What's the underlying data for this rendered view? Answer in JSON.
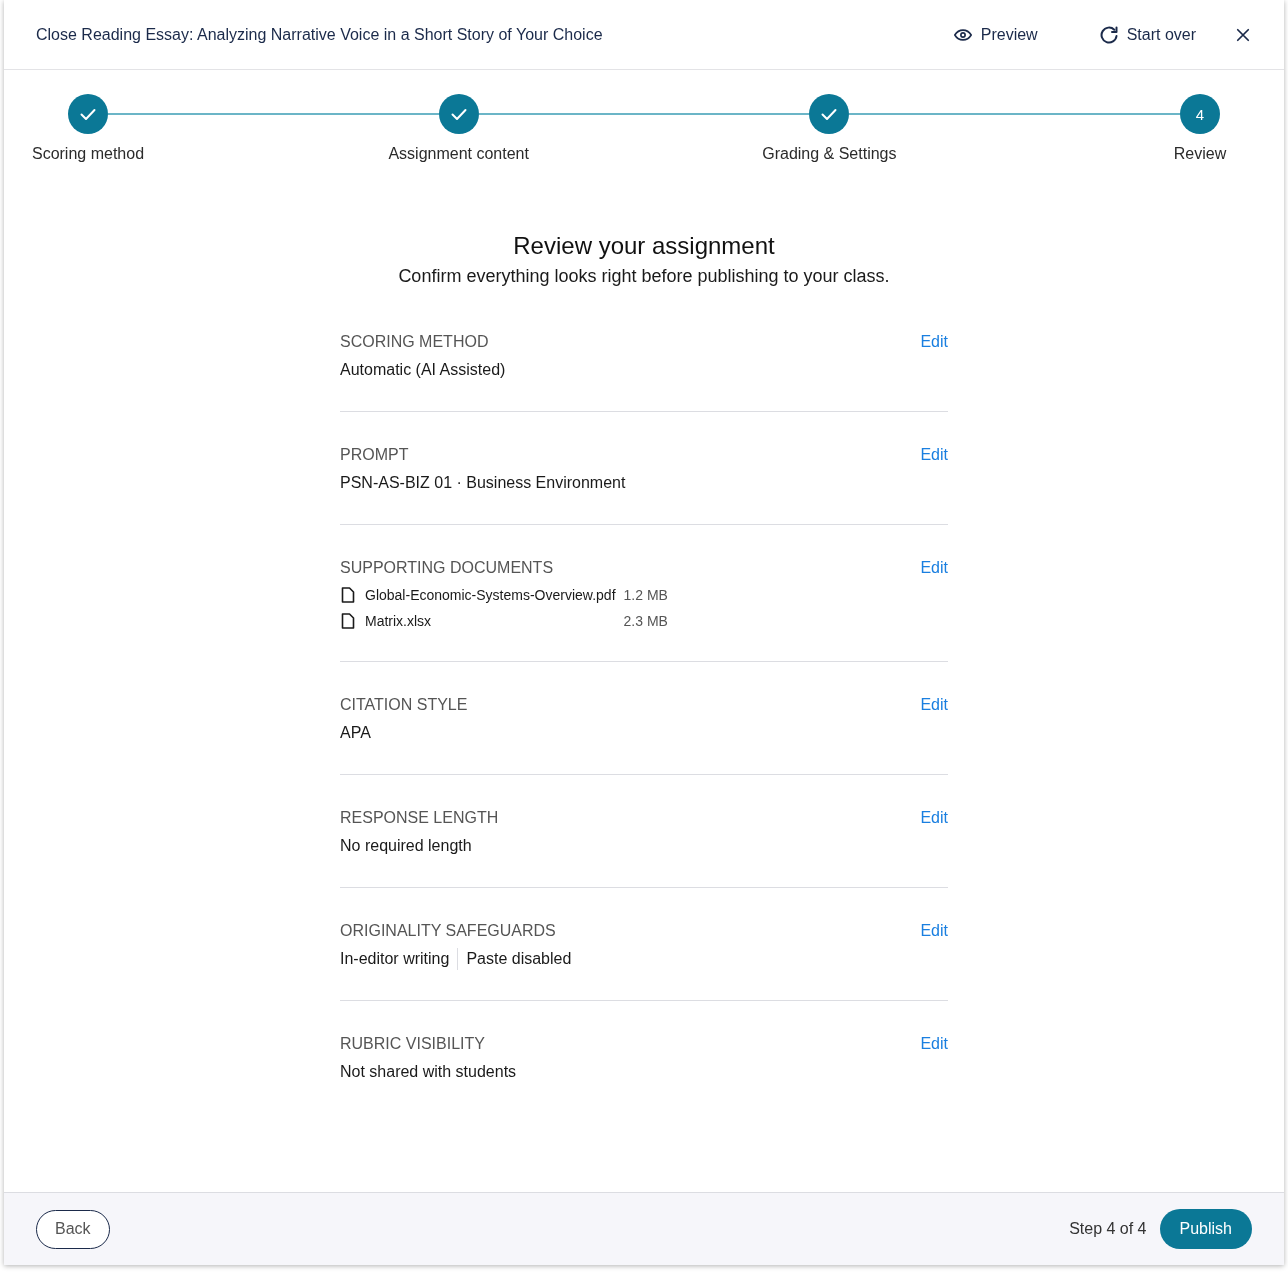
{
  "header": {
    "title": "Close Reading Essay: Analyzing Narrative Voice in a Short Story of Your Choice",
    "actions": [
      {
        "kind": "preview",
        "label": "Preview"
      },
      {
        "kind": "restart",
        "label": "Start over"
      }
    ]
  },
  "stepper": [
    {
      "label": "Scoring method",
      "completed": true
    },
    {
      "label": "Assignment content",
      "completed": true
    },
    {
      "label": "Grading & Settings",
      "completed": true
    },
    {
      "label": "Review",
      "completed": false,
      "number": "4"
    }
  ],
  "review": {
    "title": "Review your assignment",
    "subtitle": "Confirm everything looks right before publishing to your class.",
    "sections": [
      {
        "kind": "text",
        "heading": "SCORING METHOD",
        "edit": "Edit",
        "value": "Automatic (AI Assisted)"
      },
      {
        "kind": "text",
        "heading": "PROMPT",
        "edit": "Edit",
        "value": "PSN-AS-BIZ 01 · Business Environment"
      },
      {
        "kind": "files",
        "heading": "SUPPORTING DOCUMENTS",
        "edit": "Edit",
        "files": [
          {
            "name": "Global-Economic-Systems-Overview.pdf",
            "size": "1.2 MB"
          },
          {
            "name": "Matrix.xlsx",
            "size": "2.3 MB"
          }
        ]
      },
      {
        "kind": "text",
        "heading": "CITATION STYLE",
        "edit": "Edit",
        "value": "APA"
      },
      {
        "kind": "text",
        "heading": "RESPONSE LENGTH",
        "edit": "Edit",
        "value": "No required length"
      },
      {
        "kind": "tags",
        "heading": "ORIGINALITY SAFEGUARDS",
        "edit": "Edit",
        "tags": [
          "In-editor writing",
          "Paste disabled"
        ]
      },
      {
        "kind": "text",
        "heading": "RUBRIC VISIBILITY",
        "edit": "Edit",
        "value": "Not shared with students"
      }
    ]
  },
  "footer": {
    "back": "Back",
    "step": "Step 4 of 4",
    "publish": "Publish"
  }
}
